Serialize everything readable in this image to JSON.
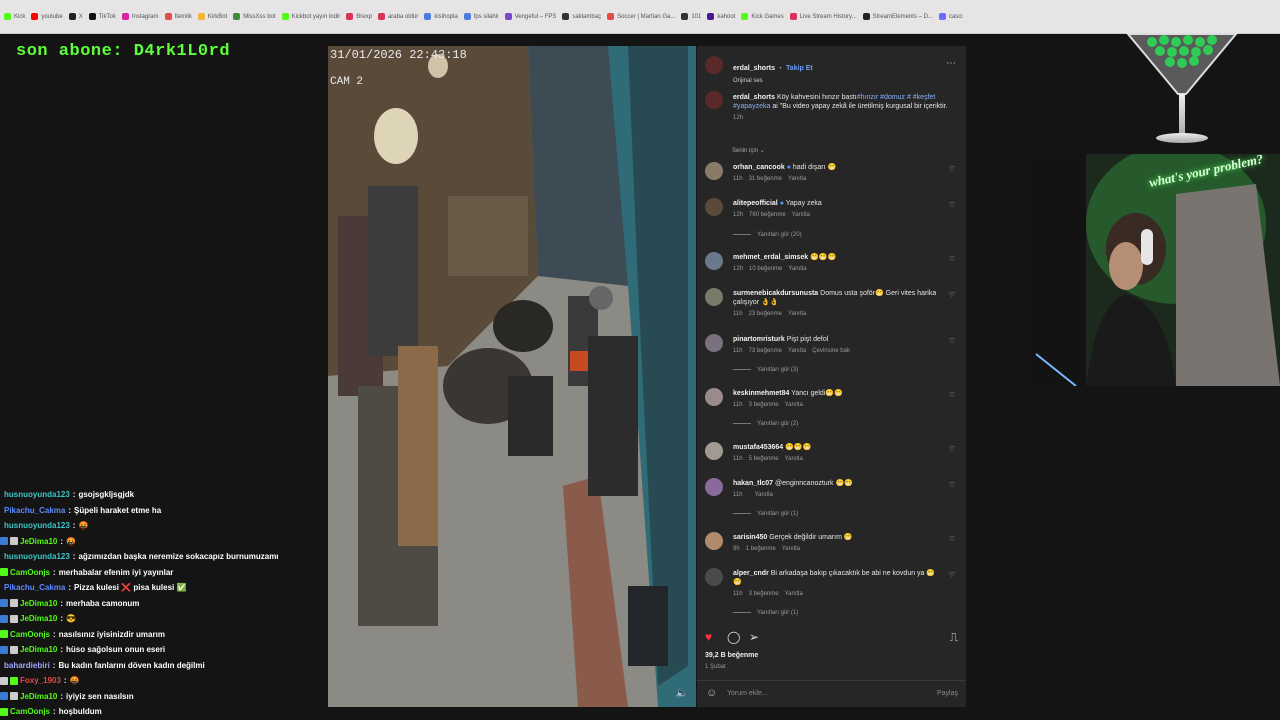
{
  "bookmarks": [
    {
      "label": "Kick",
      "color": "#53fc18"
    },
    {
      "label": "youtube",
      "color": "#ff0000"
    },
    {
      "label": "X",
      "color": "#222222"
    },
    {
      "label": "TikTok",
      "color": "#111111"
    },
    {
      "label": "Instagram",
      "color": "#d6249f"
    },
    {
      "label": "Itemlik",
      "color": "#e0504a"
    },
    {
      "label": "KirkBot",
      "color": "#f2b632"
    },
    {
      "label": "MissXss bot",
      "color": "#3f8b3f"
    },
    {
      "label": "Kickbot yayın indir",
      "color": "#53fc18"
    },
    {
      "label": "Brexp",
      "color": "#d6335a"
    },
    {
      "label": "araba oldür",
      "color": "#d6335a"
    },
    {
      "label": "kisihopla",
      "color": "#4a7fe0"
    },
    {
      "label": "fps silahlı",
      "color": "#4a7fe0"
    },
    {
      "label": "Vengeful – FPS",
      "color": "#7a47c8"
    },
    {
      "label": "saklambaç",
      "color": "#333333"
    },
    {
      "label": "Soccer | Martian Ga...",
      "color": "#e04a4a"
    },
    {
      "label": "101",
      "color": "#333333"
    },
    {
      "label": "kahoot",
      "color": "#46178f"
    },
    {
      "label": "Kick Games",
      "color": "#53fc18"
    },
    {
      "label": "Live Stream History...",
      "color": "#d6335a"
    },
    {
      "label": "StreamElements – D...",
      "color": "#222222"
    },
    {
      "label": "casci",
      "color": "#6a6aff"
    }
  ],
  "sub_banner": "son abone: D4rk1L0rd",
  "video": {
    "timestamp": "31/01/2026 22:43:18",
    "camera": "CAM 2"
  },
  "post": {
    "username": "erdal_shorts",
    "follow": "Takip Et",
    "audio": "Orijinal ses",
    "caption_user": "erdal_shorts",
    "caption_text": "Köy kahvesini hınzır bastı",
    "caption_tags": "#hınzır #domuz # #keşfet #yapayzeka",
    "caption_note": "ai \"Bu video yapay zekâ ile üretilmiş kurgusal bir içeriktir.",
    "caption_time": "12h",
    "sort_label": "Senin için",
    "likes": "39,2 B beğenme",
    "date": "1 Şubat",
    "add_comment_placeholder": "Yorum ekle...",
    "share_label": "Paylaş"
  },
  "comments": [
    {
      "user": "orhan_cancook",
      "verified": true,
      "text": "hadi dışarı 😁",
      "time": "11h",
      "likes": "31 beğenme",
      "reply": "Yanıtla",
      "extra": "",
      "avatar_color": "#8a7a6a"
    },
    {
      "user": "alitepeofficial",
      "verified": true,
      "text": "Yapay zeka",
      "time": "12h",
      "likes": "760 beğenme",
      "reply": "Yanıtla",
      "extra": "",
      "avatar_color": "#5a4a3a"
    },
    {
      "user": "mehmet_erdal_simsek",
      "verified": false,
      "text": "😁😁😁",
      "time": "12h",
      "likes": "10 beğenme",
      "reply": "Yanıtla",
      "extra": "",
      "avatar_color": "#6a7a8a"
    },
    {
      "user": "surmenebicakdursunusta",
      "verified": false,
      "text": "Domus usta şoför😁 Geri vites harika çalışıyor 👌👌",
      "time": "11h",
      "likes": "23 beğenme",
      "reply": "Yanıtla",
      "extra": "",
      "avatar_color": "#7a7a6a"
    },
    {
      "user": "pinartomristurk",
      "verified": false,
      "text": "Pişt pişt defol",
      "time": "11h",
      "likes": "73 beğenme",
      "reply": "Yanıtla",
      "extra": "Çevirisine bak",
      "avatar_color": "#7a7080"
    },
    {
      "user": "keskinmehmet84",
      "verified": false,
      "text": "Yancı geldi😁😁",
      "time": "11h",
      "likes": "3 beğenme",
      "reply": "Yanıtla",
      "extra": "",
      "avatar_color": "#9a8a8a"
    },
    {
      "user": "mustafa453664",
      "verified": false,
      "text": "😁😁😁",
      "time": "11h",
      "likes": "5 beğenme",
      "reply": "Yanıtla",
      "extra": "",
      "avatar_color": "#a09a90"
    },
    {
      "user": "hakan_tlc07",
      "verified": false,
      "text": "@enginncanozturk 😁😁",
      "time": "11h",
      "likes": "",
      "reply": "Yanıtla",
      "extra": "",
      "avatar_color": "#8a6a9a"
    },
    {
      "user": "sarisin450",
      "verified": false,
      "text": "Gerçek değildir umarım 😁",
      "time": "9h",
      "likes": "1 beğenme",
      "reply": "Yanıtla",
      "extra": "",
      "avatar_color": "#b08a6a"
    },
    {
      "user": "alper_cndr",
      "verified": false,
      "text": "Bi arkadaşa bakıp çıkacaktık be abi ne kovdun ya 😁😁",
      "time": "11h",
      "likes": "3 beğenme",
      "reply": "Yanıtla",
      "extra": "",
      "avatar_color": "#4a4a4a"
    }
  ],
  "reply_links": [
    "Yanıtları gör (20)",
    "Yanıtları gör (3)",
    "Yanıtları gör (2)",
    "Yanıtları gör (1)",
    "Yanıtları gör (1)"
  ],
  "webcam": {
    "neon_text": "what's your problem?"
  },
  "chat": [
    {
      "user": "husnuoyunda123",
      "color": "#3ec6c6",
      "text": "gsojsgkljsgjdk",
      "badges": []
    },
    {
      "user": "Pikachu_Cakma",
      "color": "#5b8bff",
      "text": "Şüpeli haraket etme ha",
      "badges": []
    },
    {
      "user": "husnuoyunda123",
      "color": "#3ec6c6",
      "text": "🤬",
      "badges": []
    },
    {
      "user": "JeDima10",
      "color": "#53fc18",
      "text": "🤬",
      "badges": [
        "#3a7bd5",
        "#cccccc"
      ]
    },
    {
      "user": "husnuoyunda123",
      "color": "#3ec6c6",
      "text": "ağzımızdan başka neremize sokacapız burnumuzamı",
      "badges": []
    },
    {
      "user": "CamOonjs",
      "color": "#53fc18",
      "text": "merhabalar efenim iyi yayınlar",
      "badges": [
        "#53fc18"
      ]
    },
    {
      "user": "Pikachu_Cakma",
      "color": "#5b8bff",
      "text": "Pizza kulesi ❌ pisa kulesi ✅",
      "badges": []
    },
    {
      "user": "JeDima10",
      "color": "#53fc18",
      "text": "merhaba camonum",
      "badges": [
        "#3a7bd5",
        "#cccccc"
      ]
    },
    {
      "user": "JeDima10",
      "color": "#53fc18",
      "text": "😎",
      "badges": [
        "#3a7bd5",
        "#cccccc"
      ]
    },
    {
      "user": "CamOonjs",
      "color": "#53fc18",
      "text": "nasılsınız iyisinizdir umarım",
      "badges": [
        "#53fc18"
      ]
    },
    {
      "user": "JeDima10",
      "color": "#53fc18",
      "text": "hüso sağolsun onun eseri",
      "badges": [
        "#3a7bd5",
        "#cccccc"
      ]
    },
    {
      "user": "bahardiebiri",
      "color": "#9aa8ff",
      "text": "Bu kadın fanlarını döven kadın değilmi",
      "badges": []
    },
    {
      "user": "Foxy_1903",
      "color": "#e04a4a",
      "text": "🤬",
      "badges": [
        "#cccccc",
        "#53fc18"
      ]
    },
    {
      "user": "JeDima10",
      "color": "#53fc18",
      "text": "iyiyiz sen nasılsın",
      "badges": [
        "#3a7bd5",
        "#cccccc"
      ]
    },
    {
      "user": "CamOonjs",
      "color": "#53fc18",
      "text": "hoşbuldum",
      "badges": [
        "#53fc18"
      ]
    }
  ]
}
